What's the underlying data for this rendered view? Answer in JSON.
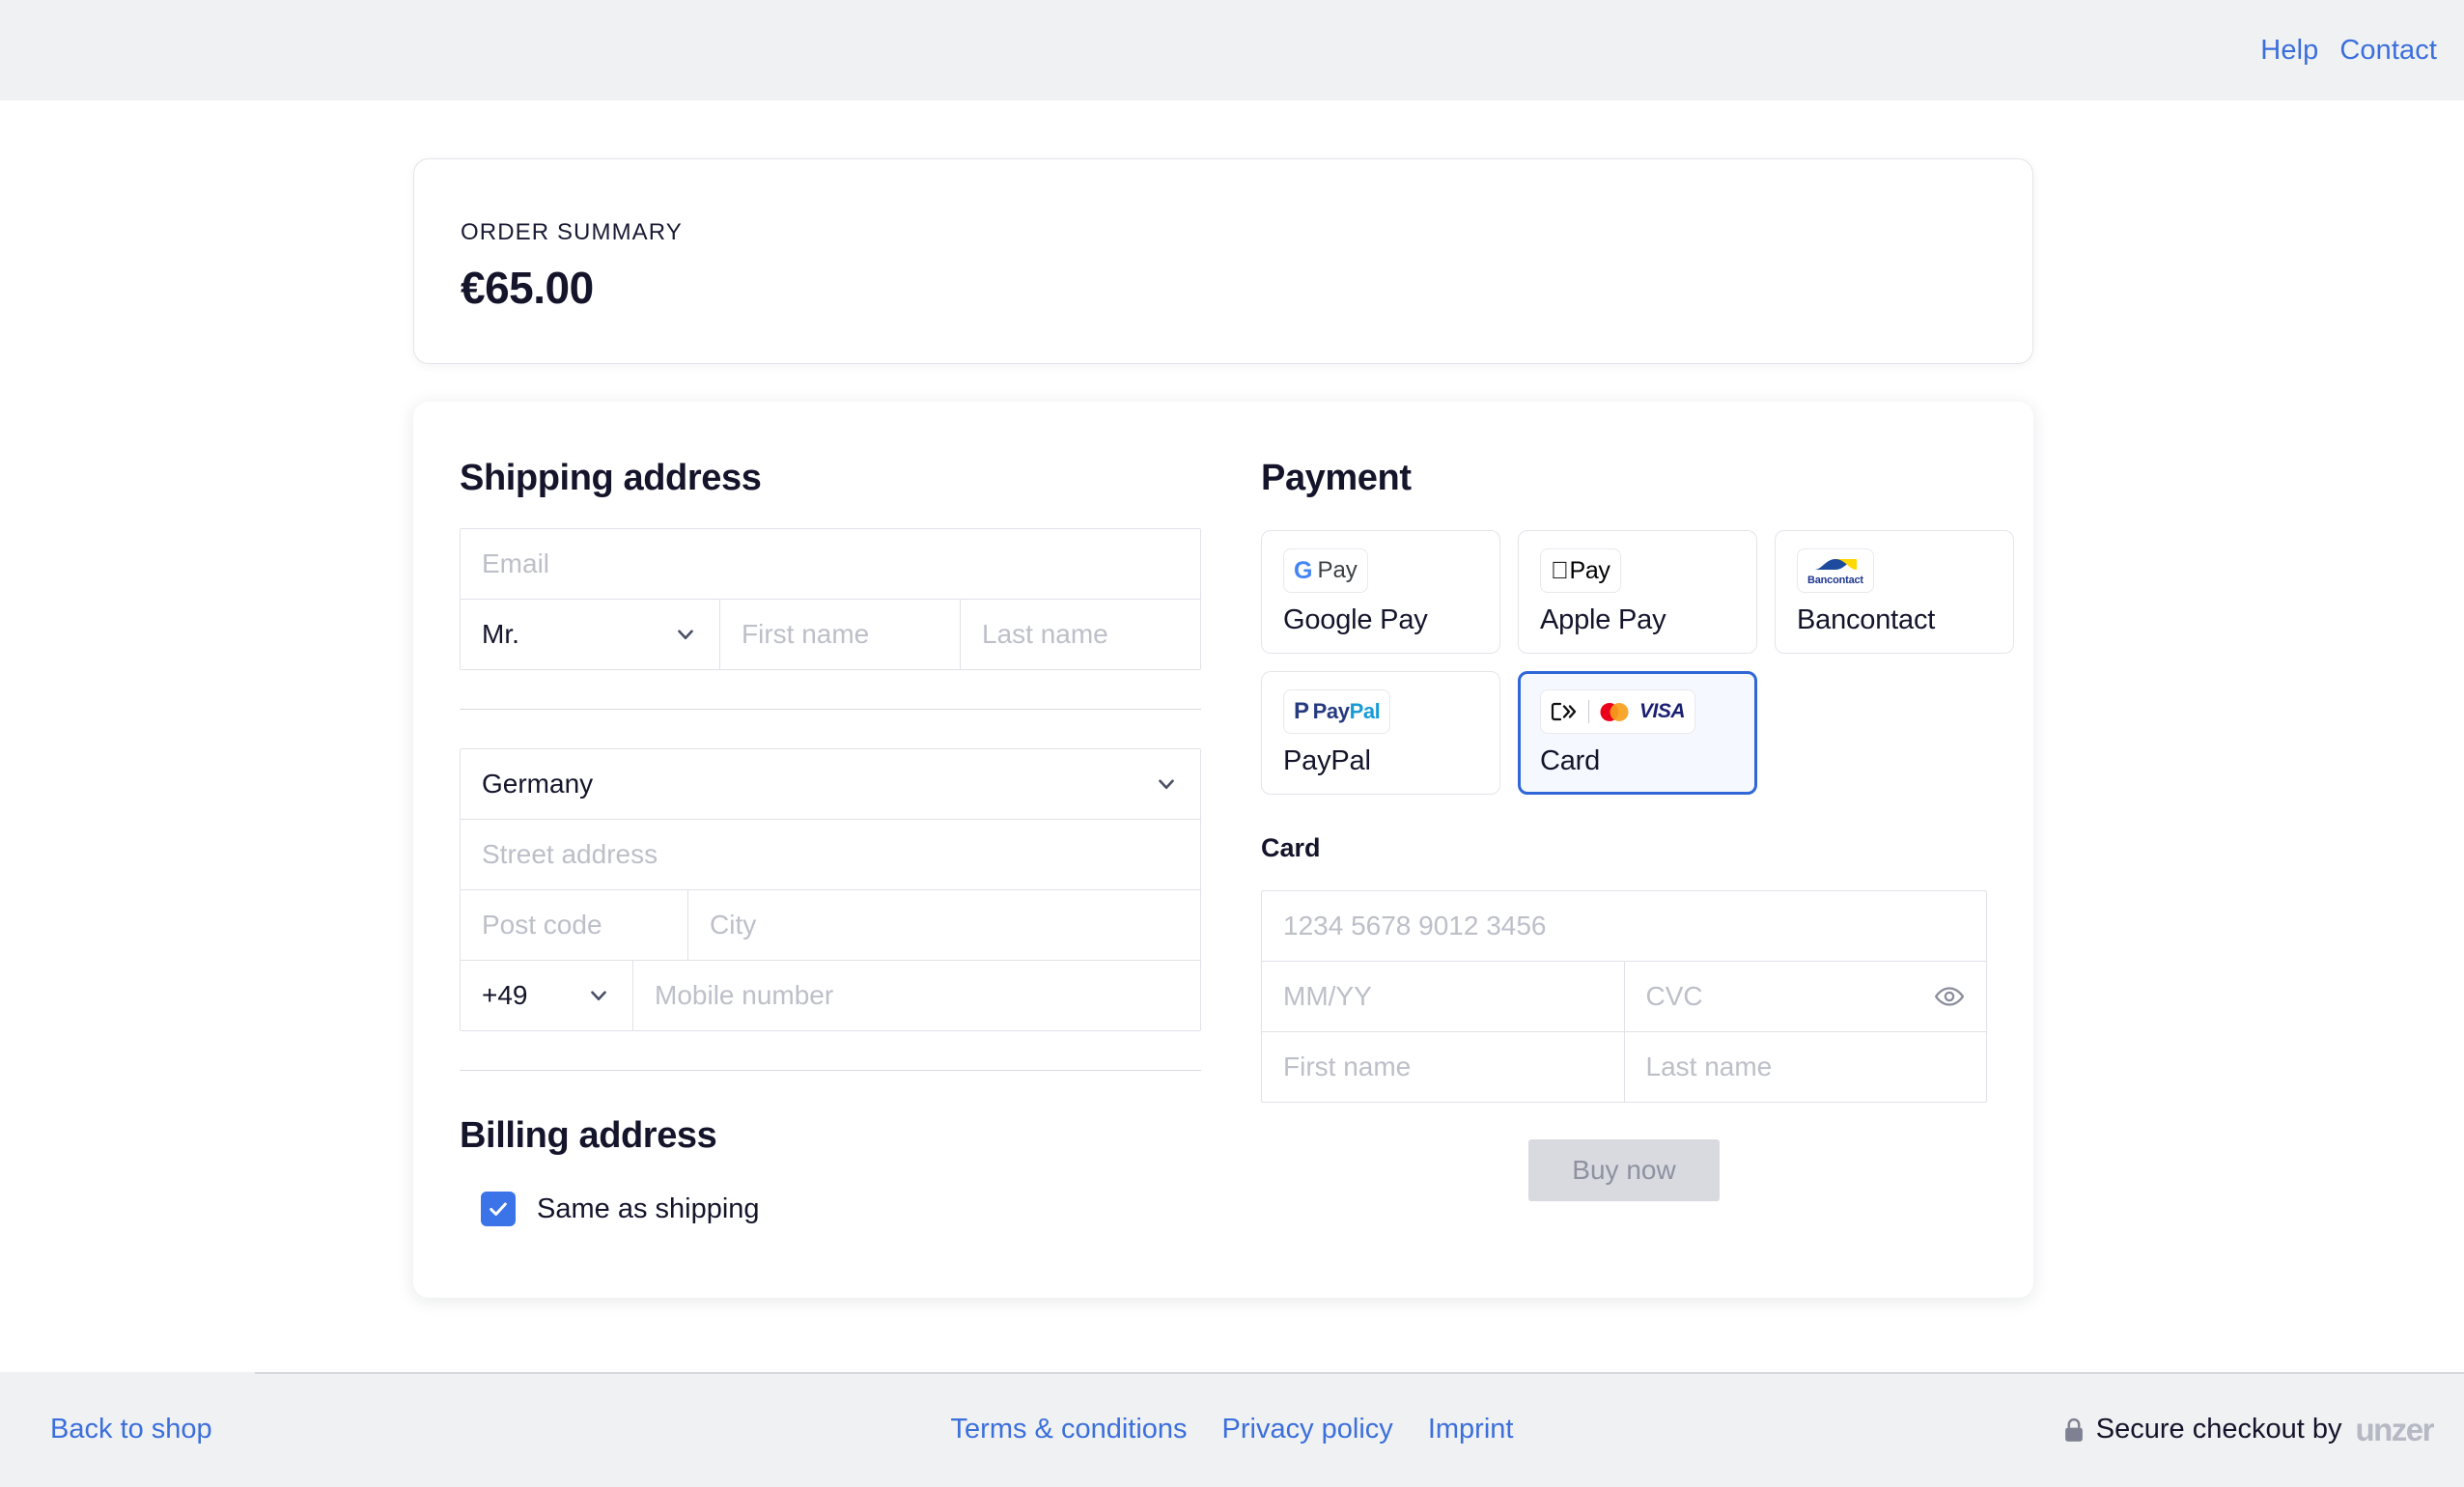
{
  "header": {
    "links": [
      {
        "label": "Help",
        "name": "help-link"
      },
      {
        "label": "Contact",
        "name": "contact-link"
      }
    ]
  },
  "order_summary": {
    "label": "ORDER SUMMARY",
    "amount": "€65.00"
  },
  "shipping": {
    "title": "Shipping address",
    "email_placeholder": "Email",
    "salutation_value": "Mr.",
    "first_name_placeholder": "First name",
    "last_name_placeholder": "Last name",
    "country_value": "Germany",
    "street_placeholder": "Street address",
    "postcode_placeholder": "Post code",
    "city_placeholder": "City",
    "country_code_value": "+49",
    "mobile_placeholder": "Mobile number"
  },
  "billing": {
    "title": "Billing address",
    "same_as_shipping_label": "Same as shipping",
    "same_as_shipping_checked": true
  },
  "payment": {
    "title": "Payment",
    "methods": [
      {
        "label": "Google Pay",
        "id": "google-pay",
        "selected": false
      },
      {
        "label": "Apple Pay",
        "id": "apple-pay",
        "selected": false
      },
      {
        "label": "Bancontact",
        "id": "bancontact",
        "selected": false
      },
      {
        "label": "PayPal",
        "id": "paypal",
        "selected": false
      },
      {
        "label": "Card",
        "id": "card",
        "selected": true
      }
    ],
    "logo_text": {
      "google_pay_g": "G",
      "google_pay_word": "Pay",
      "apple_pay_word": "Pay",
      "bancontact_word": "Bancontact",
      "paypal_p": "P",
      "paypal_pay": "Pay",
      "paypal_pal": "Pal",
      "visa": "VISA"
    },
    "card_section_title": "Card",
    "card_number_placeholder": "1234 5678 9012 3456",
    "expiry_placeholder": "MM/YY",
    "cvc_placeholder": "CVC",
    "card_first_name_placeholder": "First name",
    "card_last_name_placeholder": "Last name",
    "buy_button_label": "Buy now",
    "buy_button_enabled": false
  },
  "footer": {
    "back_to_shop": "Back to shop",
    "links": [
      {
        "label": "Terms & conditions",
        "name": "terms-link"
      },
      {
        "label": "Privacy policy",
        "name": "privacy-link"
      },
      {
        "label": "Imprint",
        "name": "imprint-link"
      }
    ],
    "secure_text": "Secure checkout by",
    "brand": "unzer"
  },
  "colors": {
    "accent_blue": "#3B6FDB",
    "selected_border": "#2F66D8",
    "checkbox_blue": "#3B73E8",
    "heading": "#14142B",
    "bar_bg": "#F0F1F3",
    "placeholder": "#BDBFC9"
  }
}
